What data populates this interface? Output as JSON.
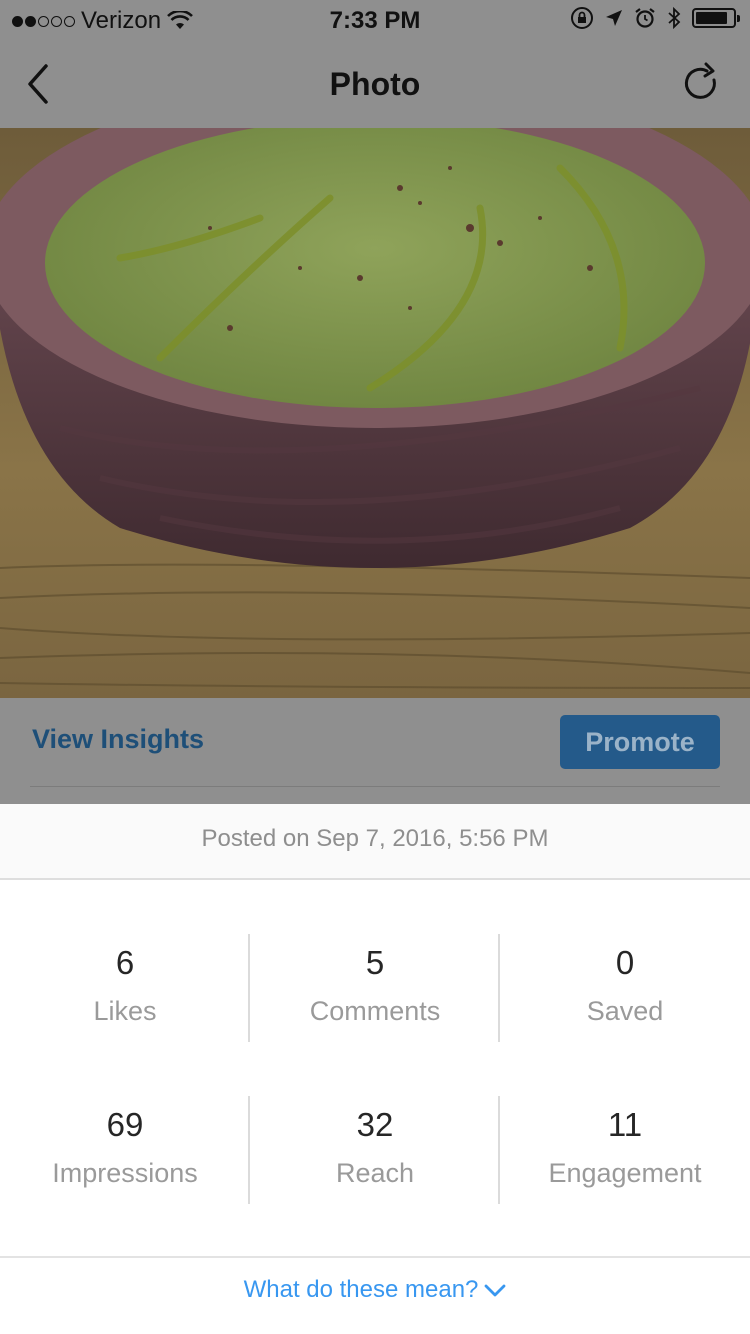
{
  "status_bar": {
    "carrier": "Verizon",
    "time": "7:33 PM",
    "signal_bars_filled": 2,
    "signal_bars_total": 5,
    "battery_level": 0.85
  },
  "nav": {
    "title": "Photo",
    "back_icon": "chevron-left-icon",
    "refresh_icon": "refresh-icon"
  },
  "photo": {
    "subject": "bowl of green soup on wooden table"
  },
  "actions": {
    "view_insights_label": "View Insights",
    "promote_label": "Promote"
  },
  "posted": {
    "text": "Posted on Sep 7, 2016, 5:56 PM"
  },
  "stats": [
    {
      "value": "6",
      "label": "Likes"
    },
    {
      "value": "5",
      "label": "Comments"
    },
    {
      "value": "0",
      "label": "Saved"
    },
    {
      "value": "69",
      "label": "Impressions"
    },
    {
      "value": "32",
      "label": "Reach"
    },
    {
      "value": "11",
      "label": "Engagement"
    }
  ],
  "help": {
    "label": "What do these mean?"
  },
  "colors": {
    "link_blue": "#3897f0",
    "promote_blue": "#245a8a",
    "overlay_gray": "#8f8f8f"
  }
}
